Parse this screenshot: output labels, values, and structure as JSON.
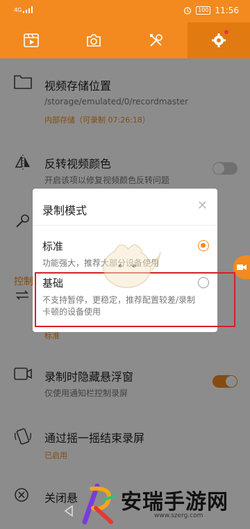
{
  "status_bar": {
    "network": "4G",
    "battery": "100",
    "time": "11:56"
  },
  "tabs": [
    {
      "name": "video-tab-icon"
    },
    {
      "name": "camera-tab-icon"
    },
    {
      "name": "tools-tab-icon"
    },
    {
      "name": "settings-tab-icon",
      "active": true
    }
  ],
  "settings": {
    "storage": {
      "title": "视频存储位置",
      "path": "/storage/emulated/0/recordmaster",
      "info": "内部存储（可录制 07:26:18）"
    },
    "invert": {
      "title": "反转视频颜色",
      "desc": "开启该项以修复视频颜色反转问题"
    },
    "control_section": "控制",
    "loop_sub": "标准",
    "hide_float": {
      "title": "录制时隐藏悬浮窗",
      "desc": "仅使用通知栏控制录屏"
    },
    "shake": {
      "title": "通过摇一摇结束录屏",
      "status": "已启用"
    },
    "close_partial": "关闭悬"
  },
  "dialog": {
    "title": "录制模式",
    "options": [
      {
        "label": "标准",
        "desc": "功能强大，推荐大部分设备使用",
        "selected": true
      },
      {
        "label": "基础",
        "desc": "不支持暂停，更稳定，推荐配置较差/录制卡顿的设备使用",
        "selected": false
      }
    ]
  },
  "watermark": {
    "title": "安瑞手游网",
    "url": "www.szerg.com"
  },
  "colors": {
    "accent": "#f28a1f",
    "highlight": "#d4202a"
  }
}
